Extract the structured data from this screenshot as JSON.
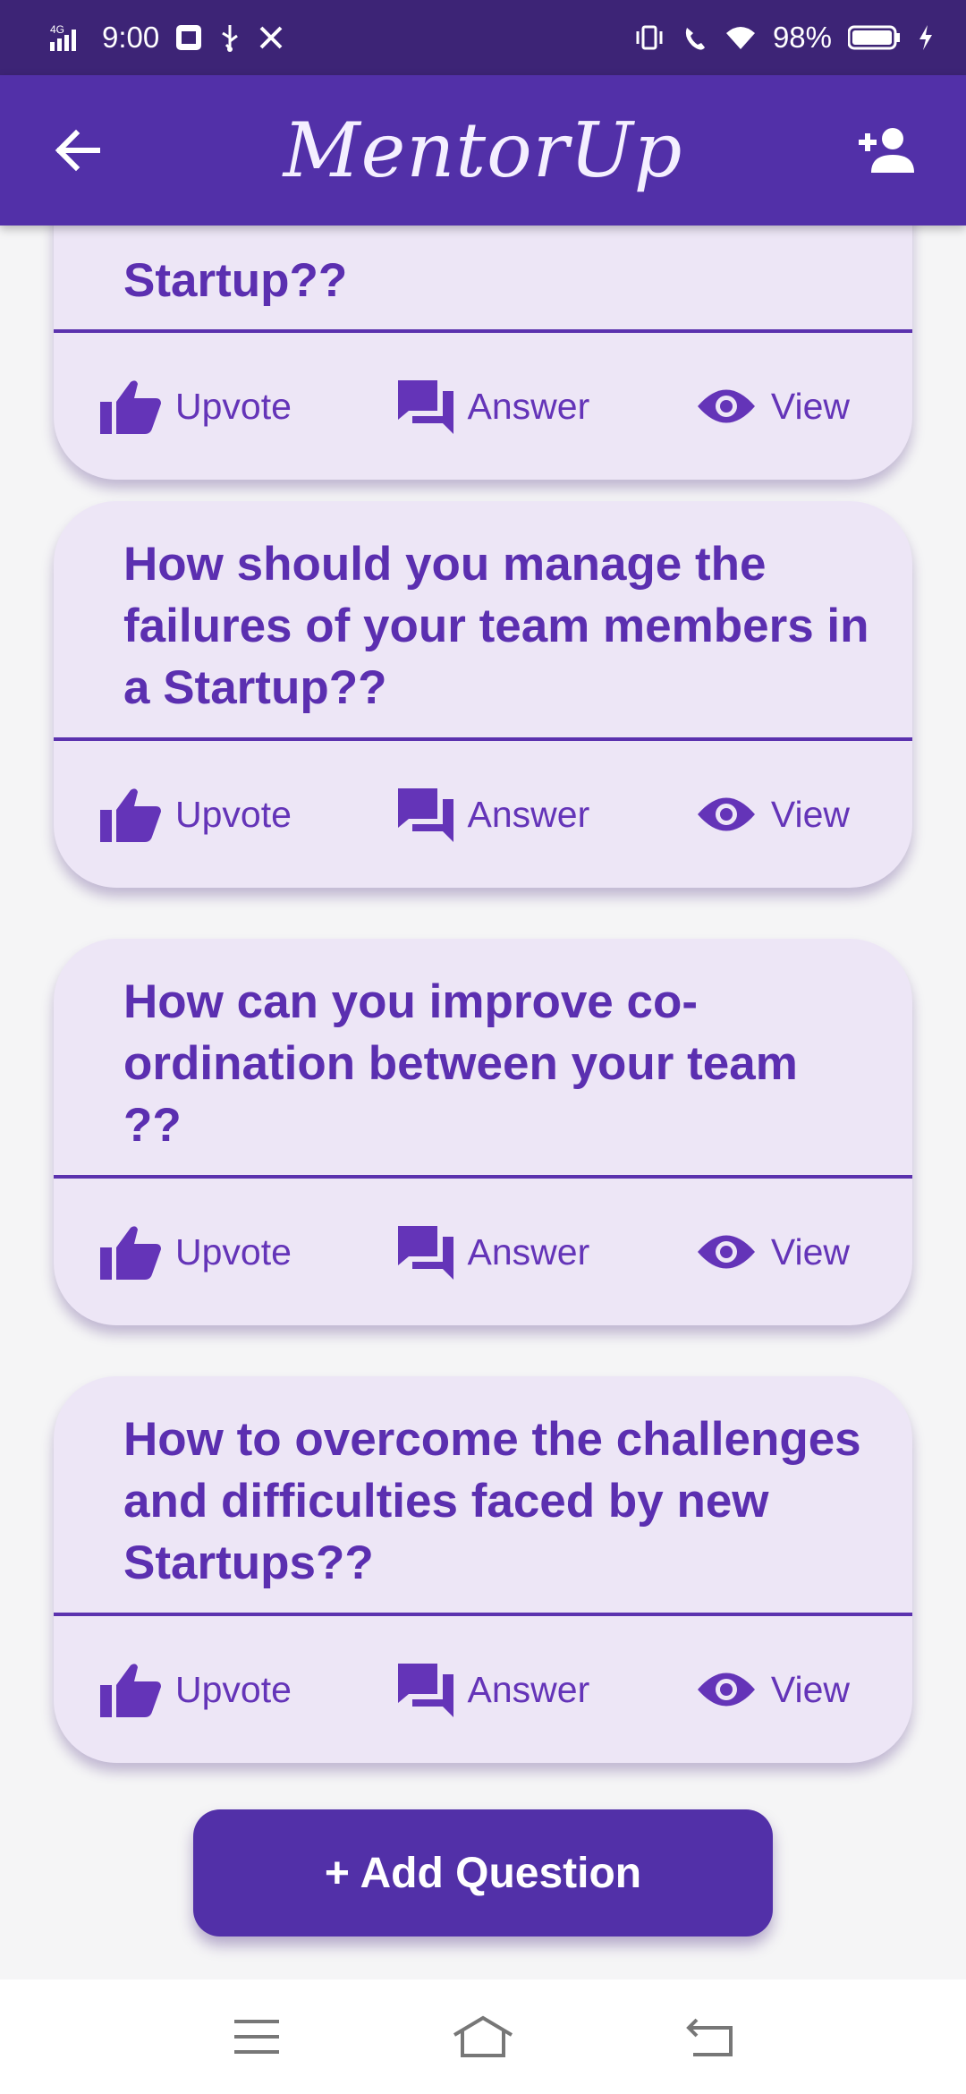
{
  "status_bar": {
    "network": "4G",
    "time": "9:00",
    "battery": "98%"
  },
  "app_bar": {
    "title": "MentorUp",
    "back_icon": "arrow-left-icon",
    "add_user_icon": "person-add-icon"
  },
  "questions": [
    {
      "text": "Startup??",
      "upvote_label": "Upvote",
      "answer_label": "Answer",
      "view_label": "View"
    },
    {
      "text": "How should you manage the failures of your team members in a Startup??",
      "upvote_label": "Upvote",
      "answer_label": "Answer",
      "view_label": "View"
    },
    {
      "text": "How can you improve co-ordination between your team  ??",
      "upvote_label": "Upvote",
      "answer_label": "Answer",
      "view_label": "View"
    },
    {
      "text": "How to overcome the challenges and difficulties faced by new Startups??",
      "upvote_label": "Upvote",
      "answer_label": "Answer",
      "view_label": "View"
    }
  ],
  "add_question_label": "+ Add Question",
  "colors": {
    "primary": "#5230a8",
    "status_bar": "#3d2476",
    "card_bg": "#ede6f6",
    "accent_text": "#5b2fb0"
  }
}
